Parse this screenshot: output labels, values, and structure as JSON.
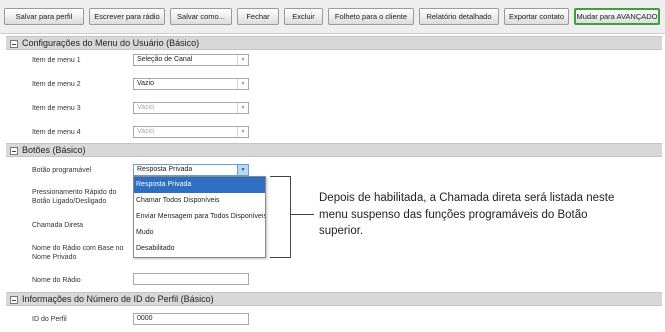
{
  "toolbar": {
    "buttons": [
      {
        "label": "Salvar para perfil"
      },
      {
        "label": "Escrever para rádio"
      },
      {
        "label": "Salvar como..."
      },
      {
        "label": "Fechar"
      },
      {
        "label": "Excluir"
      },
      {
        "label": "Folheto para o cliente"
      },
      {
        "label": "Relatório detalhado"
      },
      {
        "label": "Exportar contato"
      },
      {
        "label": "Mudar para AVANÇADO"
      }
    ]
  },
  "sections": {
    "menu": {
      "title": "Configurações do Menu do Usuário (Básico)",
      "rows": [
        {
          "label": "Item de menu 1",
          "value": "Seleção de Canal"
        },
        {
          "label": "Item de menu 2",
          "value": "Vazio"
        },
        {
          "label": "Item de menu 3",
          "value": "Vazio"
        },
        {
          "label": "Item de menu 4",
          "value": "Vazio"
        }
      ]
    },
    "buttons": {
      "title": "Botões (Básico)",
      "programmable_label": "Botão programável",
      "programmable_value": "Resposta Privada",
      "quick_press_label": "Pressionamento Rápido do Botão Ligado/Desligado",
      "direct_call_label": "Chamada Direta",
      "radio_name_based_label": "Nome do Rádio com Base no Nome Privado",
      "radio_name_label": "Nome do Rádio",
      "radio_name_value": ""
    },
    "profile": {
      "title": "Informações do Número de ID do Perfil (Básico)",
      "id_label": "ID do Perfil",
      "id_value": "0000"
    }
  },
  "dropdown": {
    "options": [
      {
        "label": "Resposta Privada"
      },
      {
        "label": "Chamar Todos Disponíveis"
      },
      {
        "label": "Enviar Mensagem para Todos Disponíveis"
      },
      {
        "label": "Mudo"
      },
      {
        "label": "Desabilitado"
      }
    ]
  },
  "callout": {
    "text": "Depois de habilitada, a Chamada direta será listada neste menu suspenso das funções programáveis do Botão superior."
  },
  "colors": {
    "toolbar_bg": "#eeeeee",
    "section_bg": "#d8d8d8",
    "selected_bg": "#2f6fc1",
    "active_button_border": "#3f9f3f"
  }
}
